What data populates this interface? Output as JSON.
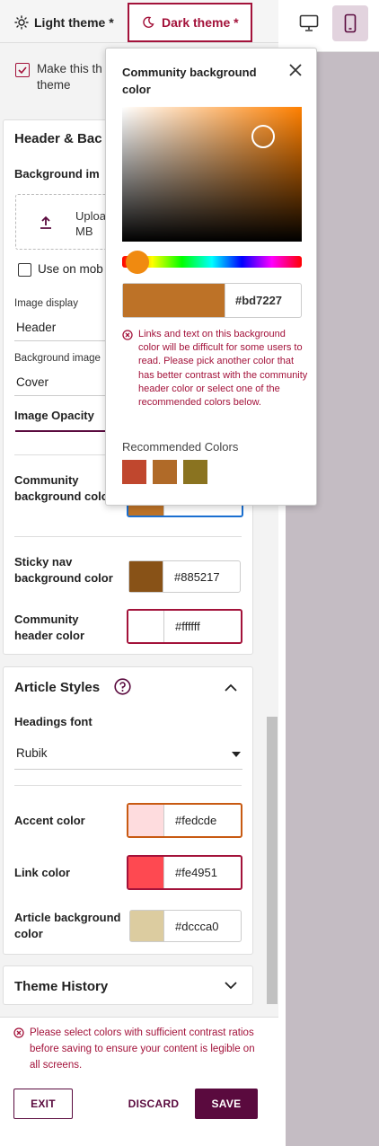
{
  "tabs": {
    "light_label": "Light theme *",
    "dark_label": "Dark theme *"
  },
  "make_default": {
    "label_line1": "Make this th",
    "label_line2": "theme"
  },
  "header_bg": {
    "title": "Header & Bac",
    "bg_image_label": "Background im",
    "upload_line1": "Uploa",
    "upload_line2": "MB",
    "use_on_mobile": "Use on mob",
    "image_display_label": "Image display",
    "image_display_value": "Header",
    "bg_image_label2": "Background image",
    "bg_image_value": "Cover",
    "image_opacity_label": "Image Opacity",
    "community_bg_label": "Community background color",
    "sticky_nav_label": "Sticky nav background color",
    "sticky_nav_hex": "#885217",
    "community_header_label": "Community header color",
    "community_header_hex": "#ffffff"
  },
  "article": {
    "title": "Article Styles",
    "headings_font_label": "Headings font",
    "headings_font_value": "Rubik",
    "accent_label": "Accent color",
    "accent_hex": "#fedcde",
    "link_label": "Link color",
    "link_hex": "#fe4951",
    "article_bg_label": "Article background color",
    "article_bg_hex": "#dccca0"
  },
  "history": {
    "title": "Theme History"
  },
  "footer": {
    "error": "Please select colors with sufficient contrast ratios before saving to ensure your content is legible on all screens.",
    "exit_label": "EXIT",
    "discard_label": "DISCARD",
    "save_label": "SAVE"
  },
  "popup": {
    "title": "Community background color",
    "hex": "#bd7227",
    "warning": "Links and text on this background color will be difficult for some users to read. Please pick another color that has better contrast with the community header color or select one of the recommended colors below.",
    "recommended_label": "Recommended Colors"
  },
  "colors": {
    "brand": "#5a0a3e",
    "error": "#a3123a",
    "community_bg": "#bd7227",
    "sticky_nav": "#885217",
    "community_header": "#ffffff",
    "accent": "#fedcde",
    "link": "#fe4951",
    "article_bg": "#dccca0",
    "recommended": [
      "#c0472e",
      "#b06a28",
      "#8a7320"
    ],
    "hue_base": "#ff8000"
  },
  "icons": {
    "light": "sun-icon",
    "dark": "moon-icon",
    "desktop": "desktop-icon",
    "mobile": "mobile-icon",
    "upload": "upload-icon",
    "help": "help-circle-icon",
    "close": "close-icon"
  }
}
